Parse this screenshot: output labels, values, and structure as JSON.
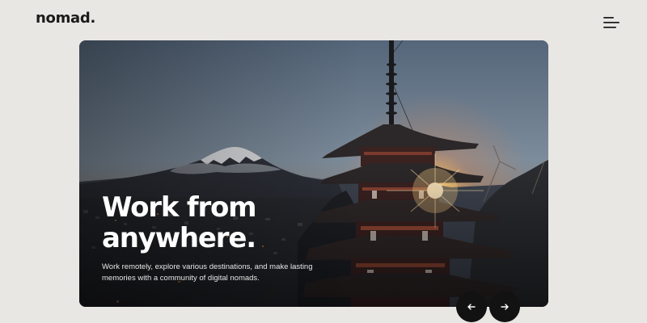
{
  "header": {
    "logo_text": "nomad.",
    "menu_icon": "hamburger-menu-icon"
  },
  "hero": {
    "image": "pagoda-with-mount-fuji-at-sunset",
    "title": "Work from anywhere.",
    "description": "Work remotely, explore various destinations, and make lasting memories with a community of digital nomads."
  },
  "carousel": {
    "prev_icon": "arrow-left-icon",
    "next_icon": "arrow-right-icon"
  },
  "colors": {
    "background": "#e9e7e4",
    "text_dark": "#1b1b1b",
    "button_dark": "#121212",
    "hero_text": "#ffffff"
  }
}
